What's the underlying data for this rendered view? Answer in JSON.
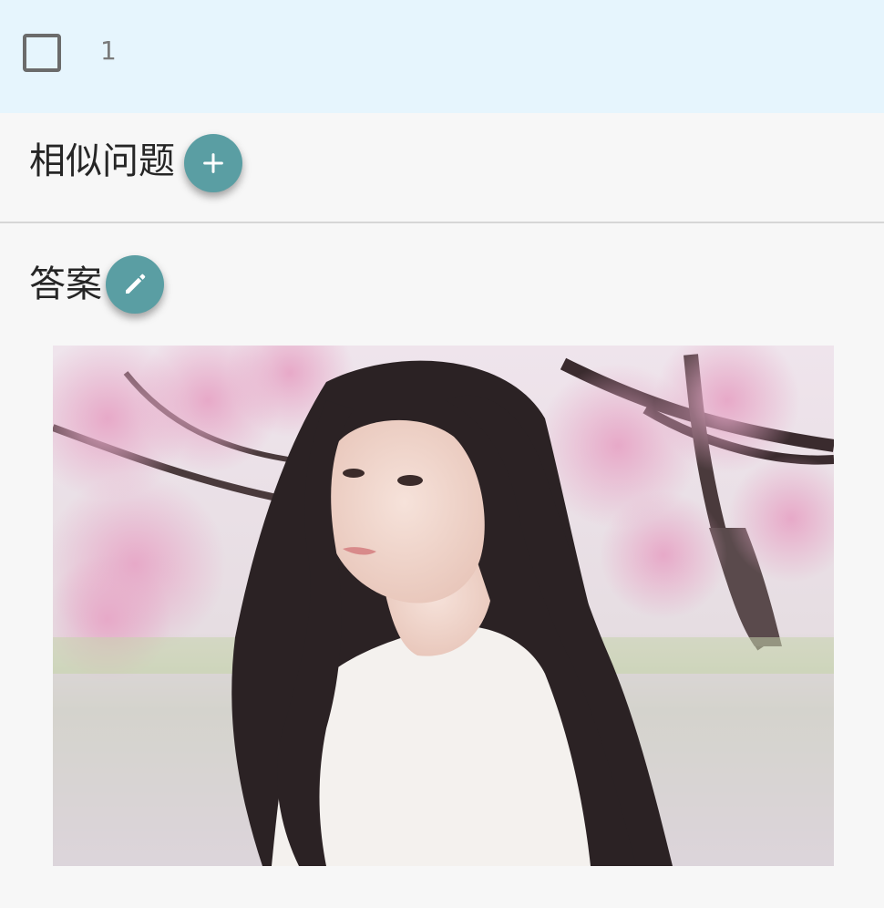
{
  "row": {
    "index": "1",
    "checkbox_checked": false
  },
  "similar_questions": {
    "title": "相似问题",
    "add_icon": "plus-icon"
  },
  "answer": {
    "title": "答案",
    "edit_icon": "pencil-icon",
    "image_icon": "photo-portrait"
  },
  "colors": {
    "header_bg": "#e6f5fd",
    "page_bg": "#f7f7f7",
    "fab_accent": "#5a9ea3",
    "divider": "#d6d6d6"
  }
}
